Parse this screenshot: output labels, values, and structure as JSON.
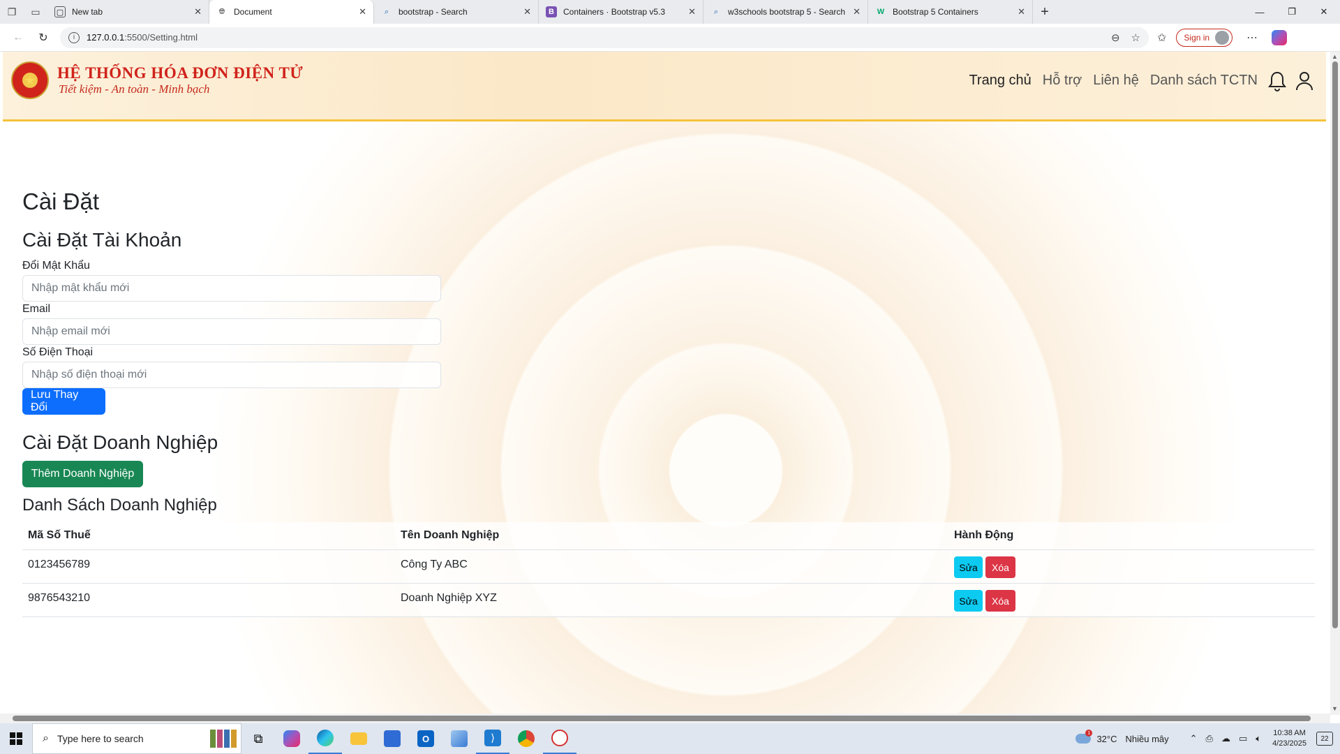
{
  "browser": {
    "tabs": [
      {
        "title": "New tab",
        "favicon": "newtab-icon"
      },
      {
        "title": "Document",
        "favicon": "globe-icon",
        "active": true
      },
      {
        "title": "bootstrap - Search",
        "favicon": "search-icon"
      },
      {
        "title": "Containers · Bootstrap v5.3",
        "favicon": "bootstrap-icon"
      },
      {
        "title": "w3schools bootstrap 5 - Search",
        "favicon": "search-icon"
      },
      {
        "title": "Bootstrap 5 Containers",
        "favicon": "w3schools-icon"
      }
    ],
    "url_host": "127.0.0.1",
    "url_path": ":5500/Setting.html",
    "signin_label": "Sign in"
  },
  "site": {
    "brand_title": "HỆ THỐNG HÓA ĐƠN ĐIỆN TỬ",
    "brand_subtitle": "Tiết kiệm - An toàn - Minh bạch",
    "nav": [
      "Trang chủ",
      "Hỗ trợ",
      "Liên hệ",
      "Danh sách TCTN"
    ]
  },
  "page": {
    "title": "Cài Đặt",
    "account": {
      "heading": "Cài Đặt Tài Khoản",
      "password_label": "Đổi Mật Khẩu",
      "password_placeholder": "Nhập mật khẩu mới",
      "email_label": "Email",
      "email_placeholder": "Nhập email mới",
      "phone_label": "Số Điện Thoại",
      "phone_placeholder": "Nhập số điện thoại mới",
      "save_label": "Lưu Thay Đổi"
    },
    "business": {
      "heading": "Cài Đặt Doanh Nghiệp",
      "add_label": "Thêm Doanh Nghiệp",
      "list_heading": "Danh Sách Doanh Nghiệp",
      "columns": [
        "Mã Số Thuế",
        "Tên Doanh Nghiệp",
        "Hành Động"
      ],
      "rows": [
        {
          "tax_code": "0123456789",
          "name": "Công Ty ABC",
          "edit": "Sửa",
          "delete": "Xóa"
        },
        {
          "tax_code": "9876543210",
          "name": "Doanh Nghiệp XYZ",
          "edit": "Sửa",
          "delete": "Xóa"
        }
      ]
    }
  },
  "taskbar": {
    "search_placeholder": "Type here to search",
    "weather_temp": "32°C",
    "weather_desc": "Nhiều mây",
    "weather_badge": "1",
    "time": "10:38 AM",
    "date": "4/23/2025",
    "notifications": "22"
  },
  "colors": {
    "primary": "#0d6efd",
    "success": "#198754",
    "info": "#0dcaf0",
    "danger": "#dc3545",
    "brand_red": "#d0231c",
    "header_border": "#f5c23a"
  }
}
